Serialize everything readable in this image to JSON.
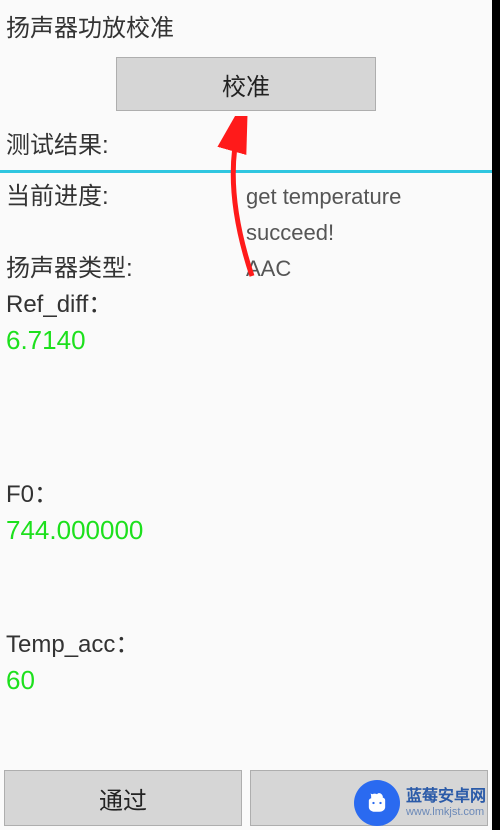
{
  "title": "扬声器功放校准",
  "calibrateButton": "校准",
  "resultLabel": "测试结果:",
  "progress": {
    "label": "当前进度:",
    "value": "get temperature succeed!"
  },
  "speakerType": {
    "label": "扬声器类型:",
    "value": "AAC"
  },
  "refDiff": {
    "label": "Ref_diff：",
    "value": "6.7140"
  },
  "f0": {
    "label": "F0：",
    "value": "744.000000"
  },
  "tempAcc": {
    "label": "Temp_acc：",
    "value": "60"
  },
  "bottom": {
    "pass": "通过",
    "fail": ""
  },
  "watermark": {
    "name": "蓝莓安卓网",
    "url": "www.lmkjst.com"
  },
  "colors": {
    "accent": "#2fc6e0",
    "metric": "#1de01d",
    "arrow": "#ff1a1a"
  }
}
